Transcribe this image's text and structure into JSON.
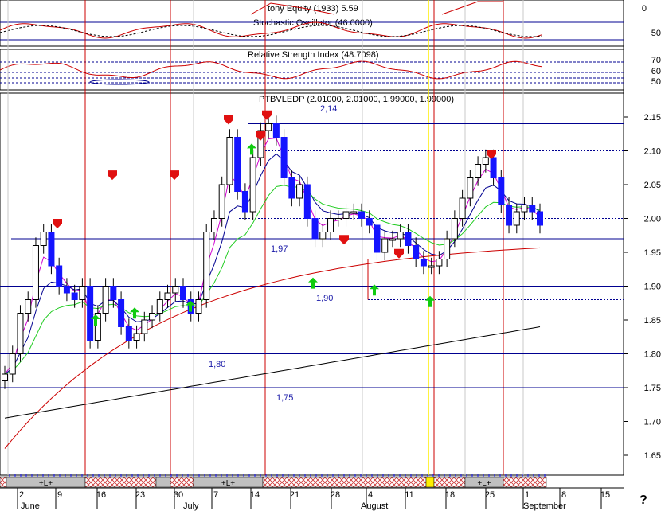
{
  "panels": {
    "top_title": "tony Equity (1933) 5.59",
    "stoch_title": "Stochastic Oscillator (46.0000)",
    "rsi_title": "Relative Strength Index (48.7098)",
    "price_title": "PTBVLEDP (2.01000, 2.01000, 1.99000, 1.99000)",
    "help_glyph": "?"
  },
  "axes": {
    "top_ticks": [
      "0"
    ],
    "stoch_ticks": [
      "50"
    ],
    "rsi_ticks": [
      "70",
      "60",
      "50"
    ],
    "price_ticks": [
      "2.15",
      "2.10",
      "2.05",
      "2.00",
      "1.95",
      "1.90",
      "1.85",
      "1.80",
      "1.75",
      "1.70",
      "1.65"
    ],
    "price_tick_values": [
      2.15,
      2.1,
      2.05,
      2.0,
      1.95,
      1.9,
      1.85,
      1.8,
      1.75,
      1.7,
      1.65
    ],
    "ylim": [
      1.62,
      2.19
    ]
  },
  "annotations": [
    {
      "text": "2,14",
      "value": 2.14
    },
    {
      "text": "1,97",
      "value": 1.97
    },
    {
      "text": "1,90",
      "value": 1.9
    },
    {
      "text": "1,80",
      "value": 1.8
    },
    {
      "text": "1,75",
      "value": 1.75
    }
  ],
  "date_axis": {
    "day_labels": [
      "2",
      "9",
      "16",
      "23",
      "30",
      "7",
      "14",
      "21",
      "28",
      "4",
      "11",
      "18",
      "25",
      "1",
      "8",
      "15"
    ],
    "month_labels": [
      "June",
      "July",
      "August",
      "September"
    ],
    "band_label": "+L+"
  },
  "colors": {
    "blue_candle": "#1414ff",
    "red_line": "#cc0000",
    "green_line": "#22cc22",
    "magenta_line": "#d000d0",
    "navy_line": "#000090",
    "hatch": "#cc3333",
    "band_gray": "#c0c0c0",
    "yellow_marker": "#ffee00",
    "arrow_down": "#e01010",
    "arrow_up": "#10cc10"
  },
  "chart_data": {
    "type": "candlestick",
    "title": "PTBVLEDP (2.01000, 2.01000, 1.99000, 1.99000)",
    "ylim": [
      1.62,
      2.19
    ],
    "candles_close": [
      1.77,
      1.8,
      1.86,
      1.88,
      1.96,
      1.98,
      1.93,
      1.9,
      1.89,
      1.88,
      1.9,
      1.82,
      1.86,
      1.9,
      1.88,
      1.84,
      1.82,
      1.83,
      1.85,
      1.86,
      1.88,
      1.89,
      1.9,
      1.88,
      1.86,
      1.88,
      1.98,
      2.0,
      2.05,
      2.12,
      2.04,
      2.01,
      2.09,
      2.13,
      2.14,
      2.12,
      2.06,
      2.03,
      2.05,
      2.0,
      1.97,
      1.98,
      2.0,
      2.0,
      2.01,
      2.01,
      2.0,
      1.99,
      1.95,
      1.97,
      1.97,
      1.98,
      1.96,
      1.94,
      1.93,
      1.93,
      1.94,
      1.97,
      2.0,
      2.03,
      2.06,
      2.08,
      2.09,
      2.06,
      2.02,
      1.99,
      2.01,
      2.02,
      2.01,
      1.99
    ],
    "support_levels": [
      2.14,
      1.97,
      1.9,
      1.8,
      1.75
    ],
    "dotted_levels": [
      2.1,
      2.0,
      1.88
    ]
  }
}
